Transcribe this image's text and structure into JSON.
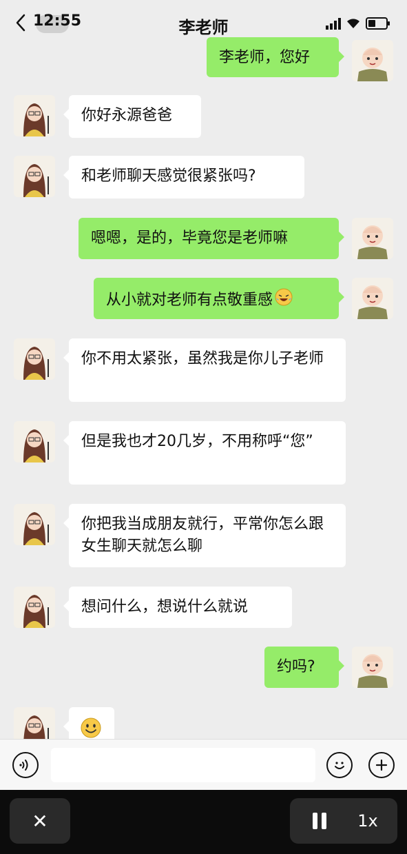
{
  "status_bar": {
    "time": "12:55"
  },
  "header": {
    "back_icon": "chevron-left-icon",
    "title": "李老师"
  },
  "messages": [
    {
      "from": "me",
      "text": "李老师，您好"
    },
    {
      "from": "teacher",
      "text": "你好永源爸爸"
    },
    {
      "from": "teacher",
      "text": "和老师聊天感觉很紧张吗?"
    },
    {
      "from": "me",
      "text": "嗯嗯，是的，毕竟您是老师嘛"
    },
    {
      "from": "me",
      "text": "从小就对老师有点敬重感",
      "emoji": "laughing-crying-emoji"
    },
    {
      "from": "teacher",
      "text": "你不用太紧张，虽然我是你儿子老师"
    },
    {
      "from": "teacher",
      "text": "但是我也才20几岁，不用称呼“您”"
    },
    {
      "from": "teacher",
      "text": "你把我当成朋友就行，平常你怎么跟女生聊天就怎么聊"
    },
    {
      "from": "teacher",
      "text": "想问什么，想说什么就说"
    },
    {
      "from": "me",
      "text": "约吗?"
    },
    {
      "from": "teacher",
      "text": "",
      "emoji": "smile-emoji"
    }
  ],
  "input_bar": {
    "voice_icon": "voice-icon",
    "emoji_icon": "emoji-icon",
    "plus_icon": "plus-icon",
    "input_value": ""
  },
  "player": {
    "close_label": "✕",
    "pause_icon": "pause-icon",
    "speed_label": "1x"
  },
  "colors": {
    "background": "#ededed",
    "outgoing_bubble": "#95ec69",
    "incoming_bubble": "#ffffff",
    "player_bg": "#0c0c0c"
  }
}
